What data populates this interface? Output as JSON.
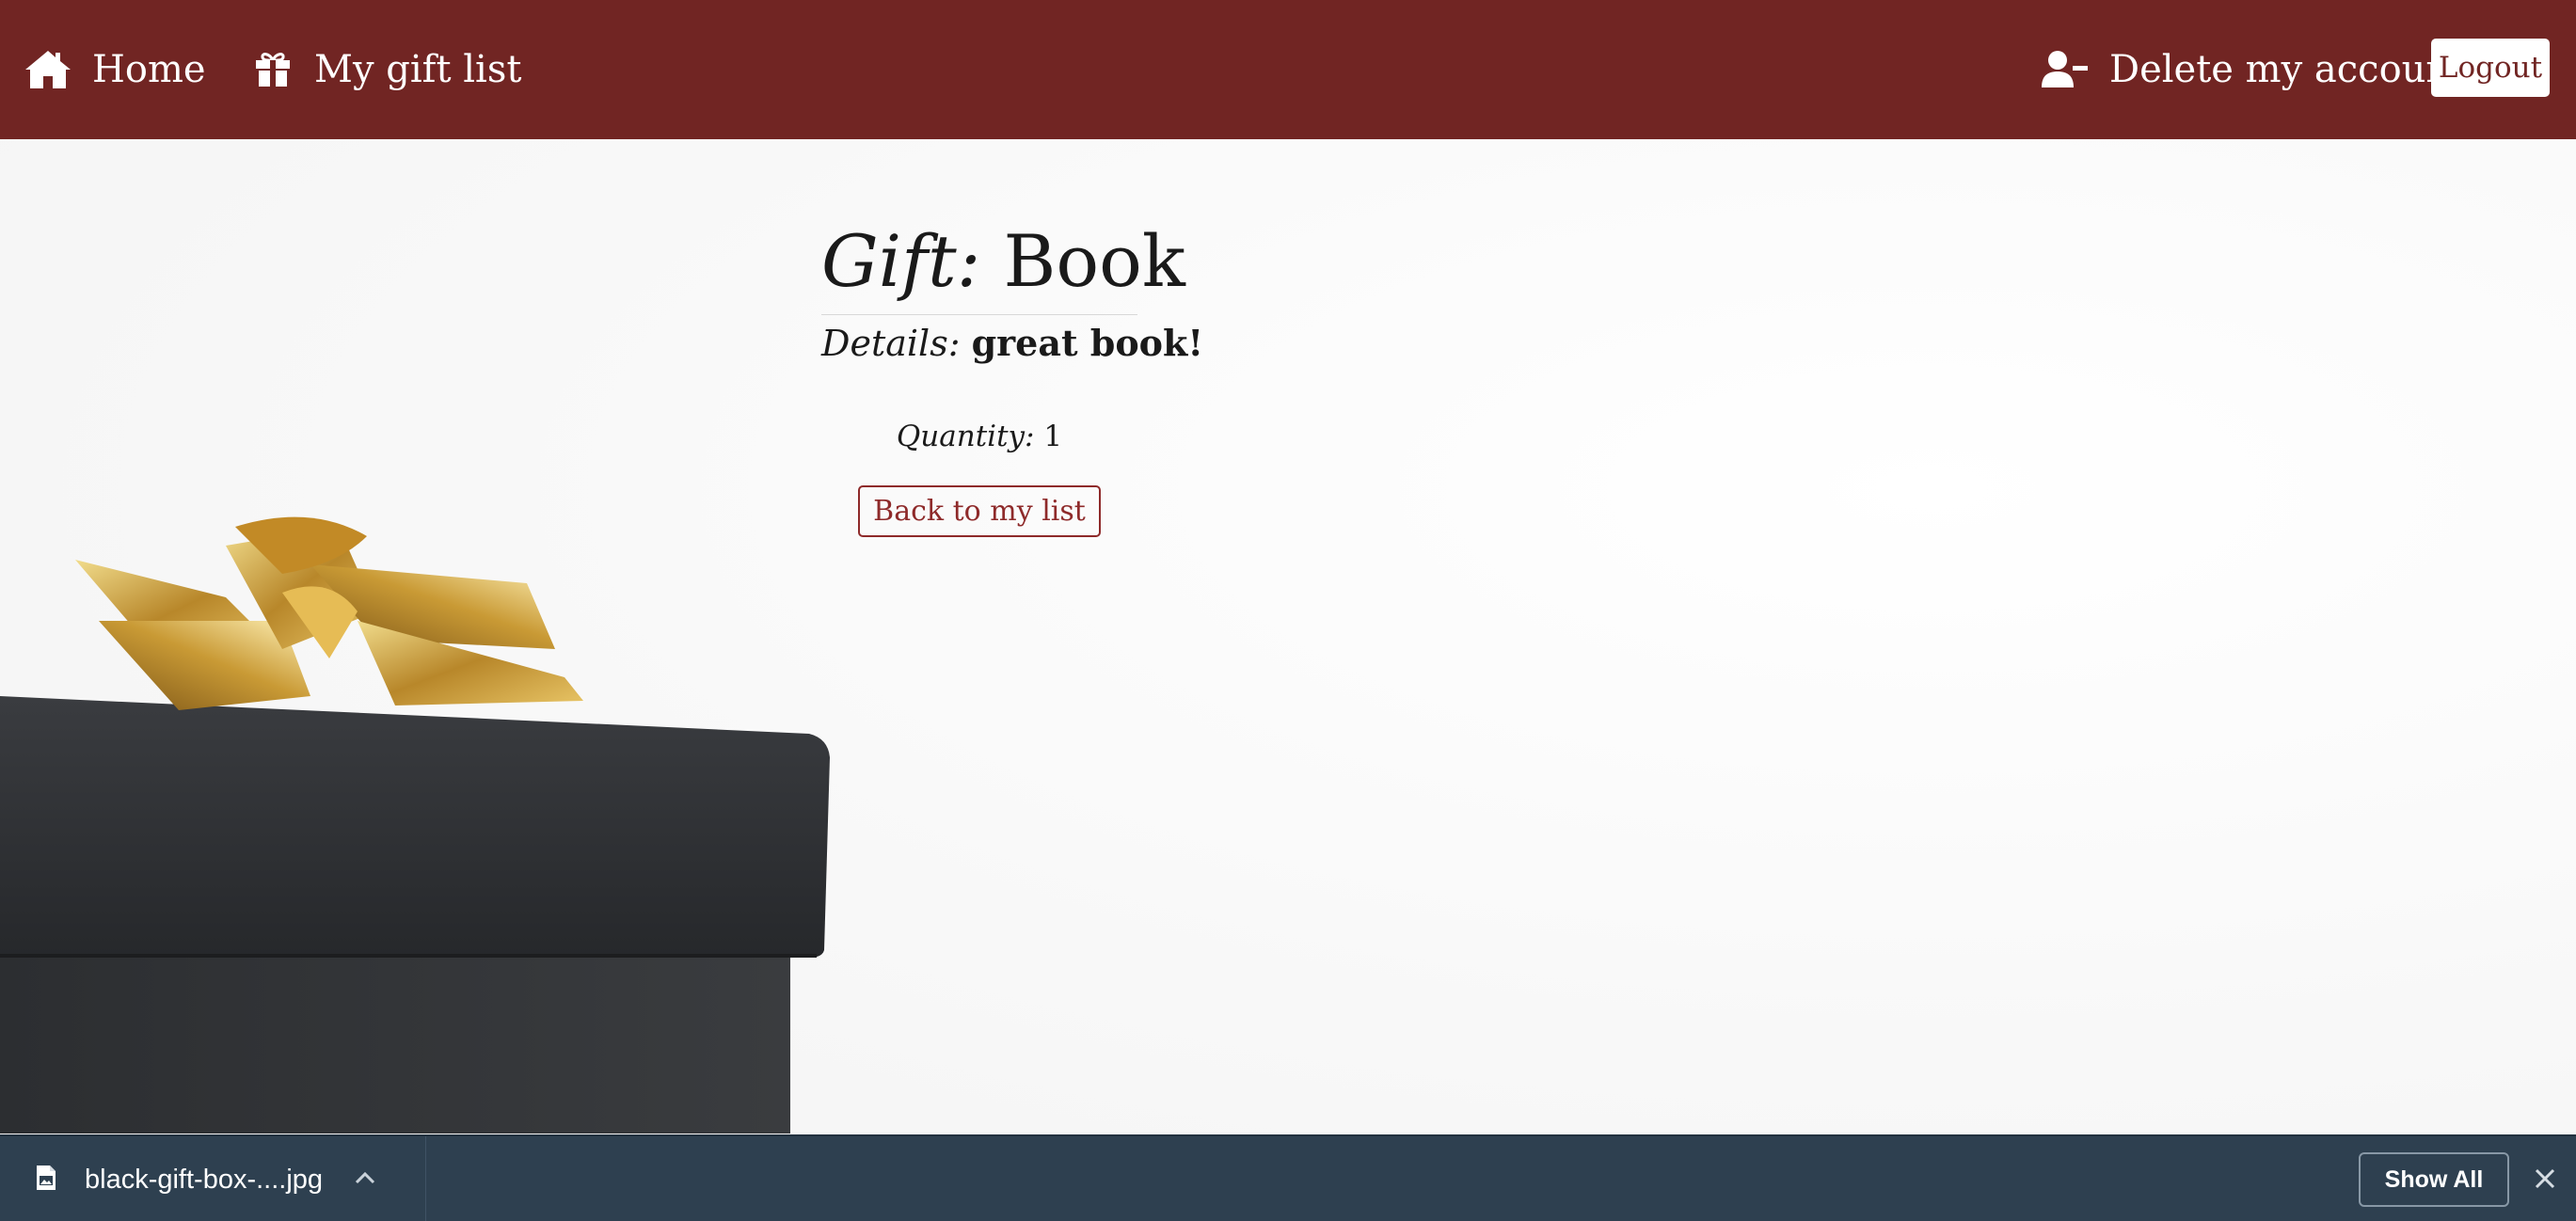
{
  "navbar": {
    "background_color": "#712523",
    "home": {
      "icon": "home-icon",
      "label": "Home"
    },
    "gift_list": {
      "icon": "gift-icon",
      "label": "My gift list"
    },
    "delete_account": {
      "icon": "user-minus-icon",
      "label": "Delete my account"
    },
    "logout_label": "Logout"
  },
  "gift": {
    "title_key": "Gift:",
    "title_value": "Book",
    "details_key": "Details:",
    "details_value": "great book!",
    "quantity_key": "Quantity:",
    "quantity_value": "1",
    "back_label": "Back to my list"
  },
  "download_bar": {
    "file_icon": "image-file-icon",
    "filename": "black-gift-box-....jpg",
    "chevron_icon": "chevron-up-icon",
    "show_all_label": "Show All",
    "close_icon": "close-icon",
    "background_color": "#2e4050"
  },
  "colors": {
    "accent": "#712523",
    "button_outline": "#8e2a2a"
  }
}
